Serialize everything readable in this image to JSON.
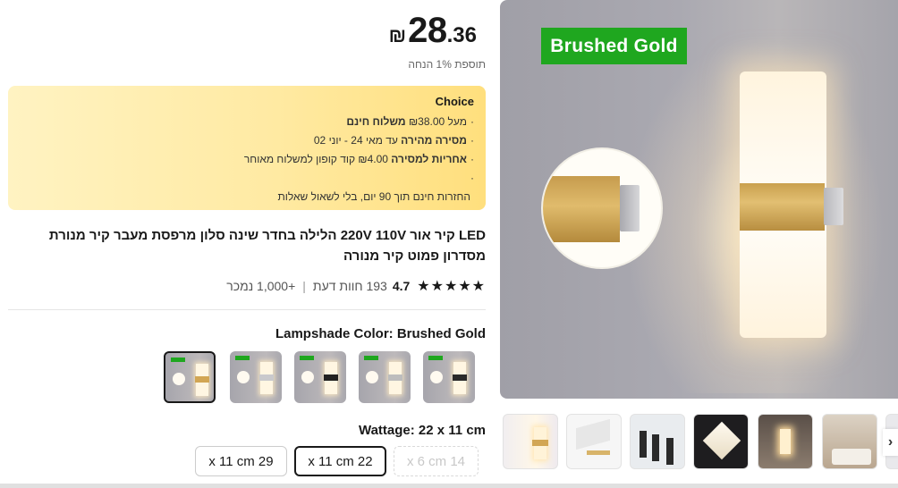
{
  "price": {
    "currency": "₪",
    "integer": "28",
    "decimal": ".36",
    "tax_note": "תוספת 1% הנחה"
  },
  "choice": {
    "title": "Choice",
    "lines": [
      {
        "bullet": "·",
        "prefix": "מעל ",
        "amount": "₪38.00",
        "bold": " משלוח חינם",
        "rest": ""
      },
      {
        "bullet": "·",
        "prefix": "",
        "amount": "",
        "bold": "מסירה מהירה",
        "rest": " עד מאי 24 - יוני 02"
      },
      {
        "bullet": "·",
        "prefix": "",
        "amount": "",
        "bold": "אחריות למסירה",
        "rest": "  ₪4.00 קוד קופון למשלוח מאוחר"
      },
      {
        "bullet": "·",
        "prefix": "",
        "amount": "",
        "bold": "",
        "rest": ""
      },
      {
        "bullet": "",
        "prefix": "",
        "amount": "",
        "bold": "",
        "rest": "החזרות חינם תוך 90 יום, בלי לשאול שאלות"
      }
    ]
  },
  "product": {
    "title": "LED קיר אור 220V 110V הלילה בחדר שינה סלון מרפסת מעבר קיר מנורת מסדרון פמוט קיר מנורה",
    "stars": "★★★★★",
    "rating": "4.7",
    "reviews": "193 חוות דעת",
    "separator": "|",
    "sold": "+1,000 נמכר"
  },
  "sku": {
    "color_label": "Lampshade Color: Brushed Gold",
    "wattage_label": "Wattage: 22 x 11 cm",
    "colors": [
      {
        "band_color": "#d2a654",
        "selected": true
      },
      {
        "band_color": "#c9c9cc",
        "selected": false
      },
      {
        "band_color": "#222222",
        "selected": false
      },
      {
        "band_color": "#bdbdbd",
        "selected": false
      },
      {
        "band_color": "#2a2a2a",
        "selected": false
      }
    ],
    "sizes": [
      {
        "label": "x 11 cm 29",
        "state": "normal"
      },
      {
        "label": "x 11 cm 22",
        "state": "selected"
      },
      {
        "label": "x 6 cm 14",
        "state": "disabled"
      }
    ]
  },
  "gallery": {
    "main_label": "Brushed Gold",
    "next_icon": "chevron-right-icon",
    "next_glyph": "›",
    "label_color": "#1fa71f"
  }
}
